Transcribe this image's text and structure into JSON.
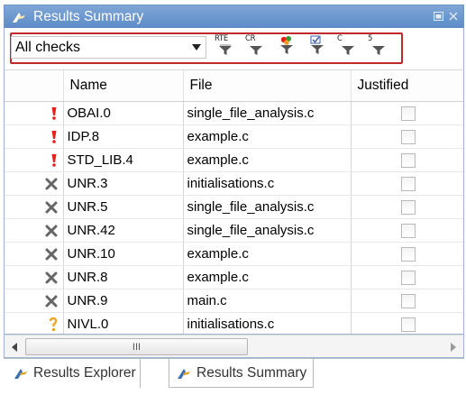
{
  "window": {
    "title": "Results Summary",
    "title_icon": "results-summary-icon",
    "restore_icon": "restore-icon",
    "close_icon": "close-icon"
  },
  "toolbar": {
    "filter_select": {
      "value": "All checks"
    },
    "filters": [
      {
        "label": "RTE",
        "icon": "funnel-rte-icon"
      },
      {
        "label": "CR",
        "icon": "funnel-cr-icon"
      },
      {
        "label": "",
        "icon": "funnel-color-icon"
      },
      {
        "label": "",
        "icon": "funnel-check-icon"
      },
      {
        "label": "C",
        "icon": "funnel-c-icon"
      },
      {
        "label": "5",
        "icon": "funnel-5-icon"
      }
    ]
  },
  "table": {
    "columns": [
      "",
      "Name",
      "File",
      "Justified"
    ],
    "rows": [
      {
        "status": "red",
        "name": "OBAI.0",
        "file": "single_file_analysis.c",
        "justified": false
      },
      {
        "status": "red",
        "name": "IDP.8",
        "file": "example.c",
        "justified": false
      },
      {
        "status": "red",
        "name": "STD_LIB.4",
        "file": "example.c",
        "justified": false
      },
      {
        "status": "gray",
        "name": "UNR.3",
        "file": "initialisations.c",
        "justified": false
      },
      {
        "status": "gray",
        "name": "UNR.5",
        "file": "single_file_analysis.c",
        "justified": false
      },
      {
        "status": "gray",
        "name": "UNR.42",
        "file": "single_file_analysis.c",
        "justified": false
      },
      {
        "status": "gray",
        "name": "UNR.10",
        "file": "example.c",
        "justified": false
      },
      {
        "status": "gray",
        "name": "UNR.8",
        "file": "example.c",
        "justified": false
      },
      {
        "status": "gray",
        "name": "UNR.9",
        "file": "main.c",
        "justified": false
      },
      {
        "status": "orange",
        "name": "NIVL.0",
        "file": "initialisations.c",
        "justified": false
      }
    ]
  },
  "scrollbar": {
    "thumb_grip": "III"
  },
  "tabs": [
    {
      "label": "Results Explorer",
      "icon": "results-explorer-icon"
    },
    {
      "label": "Results Summary",
      "icon": "results-summary-icon"
    }
  ],
  "colors": {
    "red_error": "#e8201c",
    "orange_warning": "#f0a020",
    "gray_unreachable": "#666666",
    "highlight_border": "#c0282d",
    "titlebar": "#6c96cf"
  }
}
